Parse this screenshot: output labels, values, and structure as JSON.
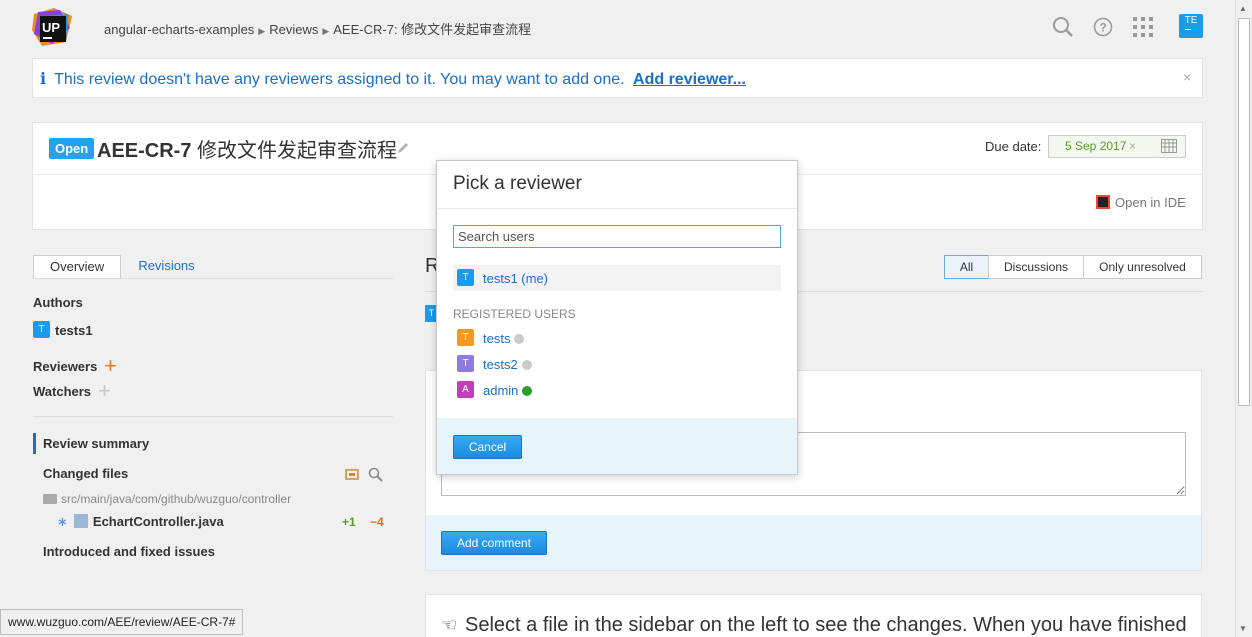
{
  "header": {
    "logo_text": "UP",
    "breadcrumb": [
      "angular-echarts-examples",
      "Reviews",
      "AEE-CR-7: 修改文件发起审查流程"
    ],
    "avatar_initials": "TE"
  },
  "notice": {
    "icon": "i",
    "message": "This review doesn't have any reviewers assigned to it. You may want to add one.",
    "action": "Add reviewer...",
    "close": "×"
  },
  "review": {
    "status": "Open",
    "id": "AEE-CR-7",
    "title": "修改文件发起审查流程",
    "due_label": "Due date:",
    "due_value": "5 Sep 2017",
    "due_clear": "×",
    "open_ide": "Open in IDE"
  },
  "sidebar": {
    "tabs": [
      "Overview",
      "Revisions"
    ],
    "authors_label": "Authors",
    "author": {
      "initial": "T",
      "name": "tests1"
    },
    "reviewers_label": "Reviewers",
    "watchers_label": "Watchers",
    "plus": "+",
    "review_summary": "Review summary",
    "changed_files": "Changed files",
    "path": "src/main/java/com/github/wuzguo/controller",
    "file": {
      "marker": "∗",
      "name": "EchartController.java",
      "added": "+1",
      "removed": "−4"
    },
    "issues": "Introduced and fixed issues"
  },
  "main": {
    "heading_initial": "R",
    "filters": [
      "All",
      "Discussions",
      "Only unresolved"
    ],
    "avatar_initial": "T",
    "add_comment": "Add comment",
    "select_hint": "Select a file in the sidebar on the left to see the changes. When you have finished"
  },
  "popup": {
    "title": "Pick a reviewer",
    "search_placeholder": "Search users",
    "me": {
      "initial": "T",
      "name": "tests1 (me)"
    },
    "registered_label": "REGISTERED USERS",
    "users": [
      {
        "initial": "T",
        "name": "tests",
        "color": "#f59a1b",
        "status_color": "#cccccc"
      },
      {
        "initial": "T",
        "name": "tests2",
        "color": "#8f7be0",
        "status_color": "#cccccc"
      },
      {
        "initial": "A",
        "name": "admin",
        "color": "#c33cb8",
        "status_color": "#2e9b2e"
      }
    ],
    "cancel": "Cancel"
  },
  "statusbar": {
    "url": "www.wuzguo.com/AEE/review/AEE-CR-7#"
  },
  "colors": {
    "accent": "#1a6fc9",
    "badge": "#28a0f0",
    "orange_plus": "#f07a1a"
  }
}
